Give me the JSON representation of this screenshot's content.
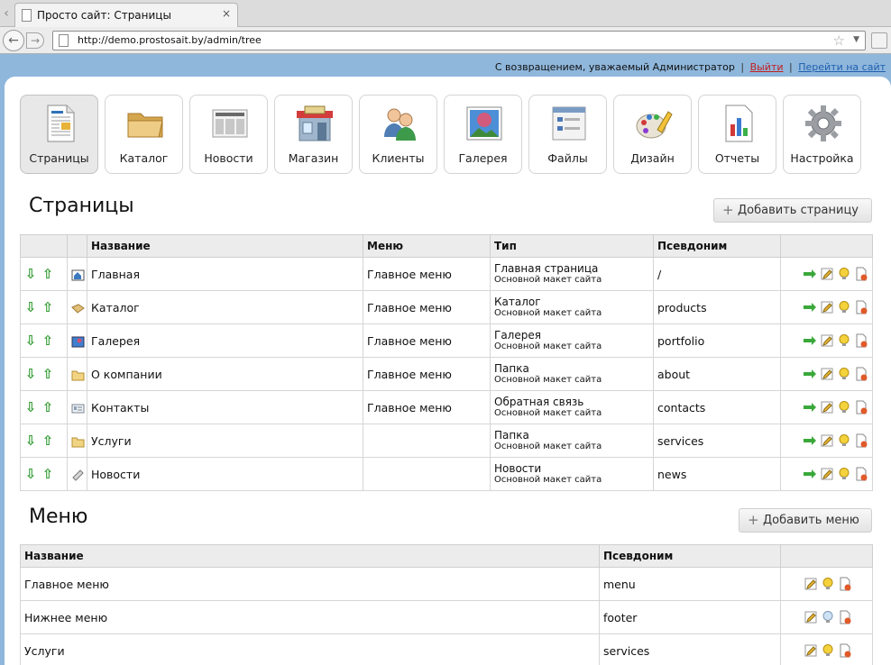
{
  "browser": {
    "tab_title": "Просто сайт: Страницы",
    "tab_close": "×",
    "url": "http://demo.prostosait.by/admin/tree"
  },
  "adminbar": {
    "welcome": "С возвращением, уважаемый Администратор",
    "separator": "|",
    "logout": "Выйти",
    "goto_site": "Перейти на сайт"
  },
  "modules": [
    {
      "label": "Страницы",
      "icon": "pages-icon"
    },
    {
      "label": "Каталог",
      "icon": "folder-icon"
    },
    {
      "label": "Новости",
      "icon": "newspaper-icon"
    },
    {
      "label": "Магазин",
      "icon": "shop-icon"
    },
    {
      "label": "Клиенты",
      "icon": "users-icon"
    },
    {
      "label": "Галерея",
      "icon": "gallery-icon"
    },
    {
      "label": "Файлы",
      "icon": "files-icon"
    },
    {
      "label": "Дизайн",
      "icon": "design-icon"
    },
    {
      "label": "Отчеты",
      "icon": "reports-icon"
    },
    {
      "label": "Настройка",
      "icon": "gear-icon"
    }
  ],
  "pages": {
    "title": "Страницы",
    "add_label": "Добавить страницу",
    "columns": [
      "Название",
      "Меню",
      "Тип",
      "Псевдоним"
    ],
    "rows": [
      {
        "name": "Главная",
        "is_link": false,
        "icon": "home-page-icon",
        "menu": "Главное меню",
        "type": "Главная страница",
        "template": "Основной макет сайта",
        "alias": "/"
      },
      {
        "name": "Каталог",
        "is_link": false,
        "icon": "catalog-icon",
        "menu": "Главное меню",
        "type": "Каталог",
        "template": "Основной макет сайта",
        "alias": "products"
      },
      {
        "name": "Галерея",
        "is_link": false,
        "icon": "gallery-icon",
        "menu": "Главное меню",
        "type": "Галерея",
        "template": "Основной макет сайта",
        "alias": "portfolio"
      },
      {
        "name": "О компании",
        "is_link": true,
        "icon": "folder-icon",
        "menu": "Главное меню",
        "type": "Папка",
        "template": "Основной макет сайта",
        "alias": "about"
      },
      {
        "name": "Контакты",
        "is_link": false,
        "icon": "contact-card-icon",
        "menu": "Главное меню",
        "type": "Обратная связь",
        "template": "Основной макет сайта",
        "alias": "contacts"
      },
      {
        "name": "Услуги",
        "is_link": true,
        "icon": "folder-icon",
        "menu": "",
        "type": "Папка",
        "template": "Основной макет сайта",
        "alias": "services"
      },
      {
        "name": "Новости",
        "is_link": false,
        "icon": "news-icon",
        "menu": "",
        "type": "Новости",
        "template": "Основной макет сайта",
        "alias": "news"
      }
    ]
  },
  "menus": {
    "title": "Меню",
    "add_label": "Добавить меню",
    "columns": [
      "Название",
      "Псевдоним"
    ],
    "rows": [
      {
        "name": "Главное меню",
        "alias": "menu",
        "bulb": "on"
      },
      {
        "name": "Нижнее меню",
        "alias": "footer",
        "bulb": "off"
      },
      {
        "name": "Услуги",
        "alias": "services",
        "bulb": "on"
      }
    ]
  },
  "colors": {
    "header_bg": "#8fb7dc",
    "link": "#1a6aa6",
    "arrow_green": "#2f9a2f",
    "logout_red": "#c02020"
  }
}
